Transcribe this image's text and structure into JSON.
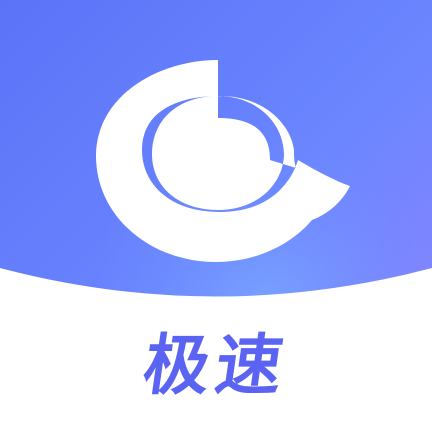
{
  "app_icon": {
    "caption": "极速",
    "icon_name": "search-ring-icon",
    "colors": {
      "gradient_start": "#5b73f8",
      "gradient_mid": "#6e8cff",
      "gradient_end": "#8f83ff",
      "ring": "#ffffff",
      "caption_text": "#5b63f2",
      "bottom_panel": "#ffffff"
    }
  }
}
